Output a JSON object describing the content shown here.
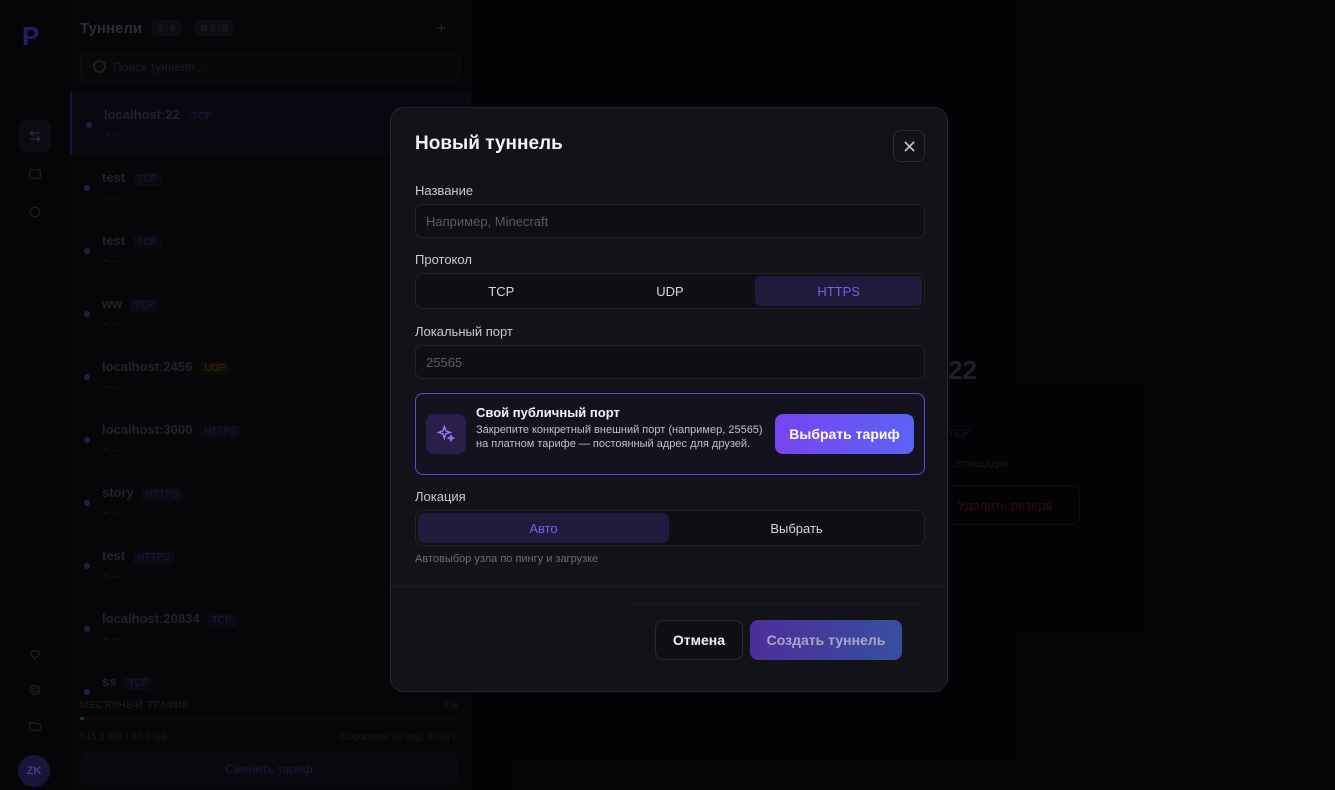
{
  "background": {
    "panel": {
      "title": "Туннели",
      "count_badge": "8 / 8",
      "limit_badge": "⊠ 8 / 8",
      "add_symbol": "+",
      "search_placeholder": "Поиск туннеля...",
      "tunnels": [
        {
          "name": "localhost:22",
          "protocol": "TCP",
          "meta": "• —"
        },
        {
          "name": "test",
          "protocol": "TCP",
          "meta": "• —"
        },
        {
          "name": "test",
          "protocol": "TCP",
          "meta": "• —"
        },
        {
          "name": "ww",
          "protocol": "TCP",
          "meta": "• —"
        },
        {
          "name": "localhost:2456",
          "protocol": "UDP",
          "meta": "• —"
        },
        {
          "name": "localhost:3000",
          "protocol": "HTTPS",
          "meta": "• —"
        },
        {
          "name": "story",
          "protocol": "HTTPS",
          "meta": "• —"
        },
        {
          "name": "test",
          "protocol": "HTTPS",
          "meta": "• —"
        },
        {
          "name": "localhost:20834",
          "protocol": "TCP",
          "meta": "• —"
        },
        {
          "name": "ss",
          "protocol": "TCP",
          "meta": "• —"
        }
      ],
      "traffic_label": "МЕСЯЧНЫЙ ТРАФИК",
      "traffic_percent": "1%",
      "traffic_fraction": 0.01,
      "traffic_used": "515.1 MB / 50.0 GB",
      "traffic_reset": "Сброшено 30 апр. 2026 г.",
      "change_plan": "Сменить тариф"
    },
    "main": {
      "port": "22",
      "protocol": "TCP",
      "hint": "...площадки",
      "delete_button": "Удалить резерв"
    },
    "avatar_initials": "ZK"
  },
  "modal": {
    "title": "Новый туннель",
    "name_label": "Название",
    "name_placeholder": "Например, Minecraft",
    "protocol_label": "Протокол",
    "protocols": [
      "TCP",
      "UDP",
      "HTTPS"
    ],
    "protocol_selected": "HTTPS",
    "port_label": "Локальный порт",
    "port_placeholder": "25565",
    "promo": {
      "title": "Свой публичный порт",
      "description": "Закрепите конкретный внешний порт (например, 25565) на платном тарифе — постоянный адрес для друзей.",
      "button": "Выбрать тариф"
    },
    "location_label": "Локация",
    "location_options": [
      "Авто",
      "Выбрать"
    ],
    "location_selected": "Авто",
    "location_hint": "Автовыбор узла по пингу и загрузке",
    "cancel_button": "Отмена",
    "create_button": "Создать туннель"
  },
  "colors": {
    "accent": "#7c5ce8",
    "promo_border": "#6a42d8",
    "udp_badge": "#c89a2a"
  }
}
